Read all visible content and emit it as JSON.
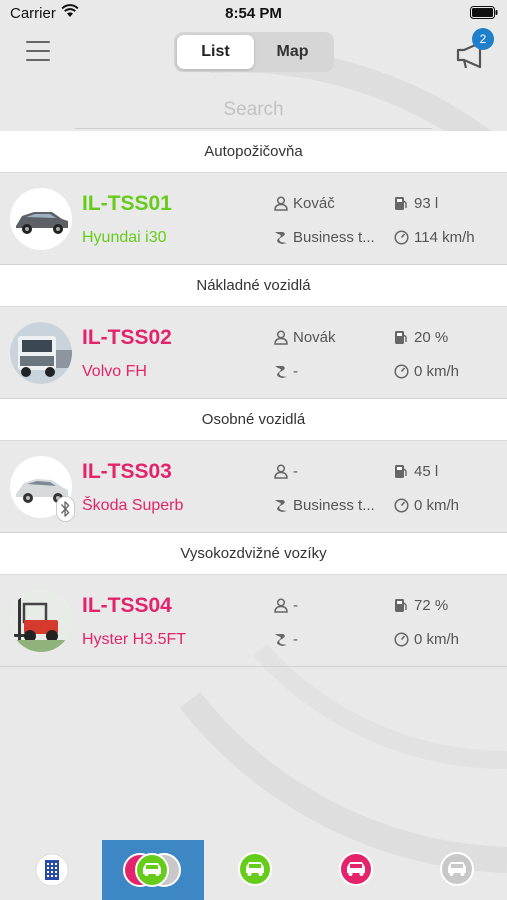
{
  "status_bar": {
    "carrier": "Carrier",
    "time": "8:54 PM"
  },
  "nav": {
    "segments": [
      {
        "label": "List",
        "selected": true
      },
      {
        "label": "Map",
        "selected": false
      }
    ],
    "notification_count": "2"
  },
  "search": {
    "placeholder": "Search",
    "value": ""
  },
  "colors": {
    "accent_green": "#66cc1a",
    "accent_pink": "#e3246b",
    "tab_active": "#3c87c4",
    "badge_blue": "#1e7fcb",
    "tab_gray": "#c8c8c8"
  },
  "sections": [
    {
      "header": "Autopožičovňa",
      "vehicle": {
        "plate": "IL-TSS01",
        "model": "Hyundai i30",
        "status_color": "#66cc1a",
        "driver": "Kováč",
        "trip_type": "Business t...",
        "fuel": "93 l",
        "speed": "114 km/h",
        "image_icon": "sedan-car-photo"
      }
    },
    {
      "header": "Nákladné vozidlá",
      "vehicle": {
        "plate": "IL-TSS02",
        "model": "Volvo FH",
        "status_color": "#e3246b",
        "driver": "Novák",
        "trip_type": "-",
        "fuel": "20 %",
        "speed": "0 km/h",
        "image_icon": "truck-photo"
      }
    },
    {
      "header": "Osobné vozidlá",
      "vehicle": {
        "plate": "IL-TSS03",
        "model": "Škoda Superb",
        "status_color": "#e3246b",
        "driver": "-",
        "trip_type": "Business t...",
        "fuel": "45 l",
        "speed": "0 km/h",
        "image_icon": "car-photo",
        "bluetooth": true
      }
    },
    {
      "header": "Vysokozdvižné vozíky",
      "vehicle": {
        "plate": "IL-TSS04",
        "model": "Hyster H3.5FT",
        "status_color": "#e3246b",
        "driver": "-",
        "trip_type": "-",
        "fuel": "72 %",
        "speed": "0 km/h",
        "image_icon": "forklift-photo"
      }
    }
  ],
  "tab_bar": {
    "tabs": [
      {
        "icon": "building-icon",
        "active": false
      },
      {
        "icon": "all-cars-icon",
        "active": true
      },
      {
        "icon": "green-car-icon",
        "active": false
      },
      {
        "icon": "pink-car-icon",
        "active": false
      },
      {
        "icon": "gray-car-icon",
        "active": false
      }
    ]
  }
}
